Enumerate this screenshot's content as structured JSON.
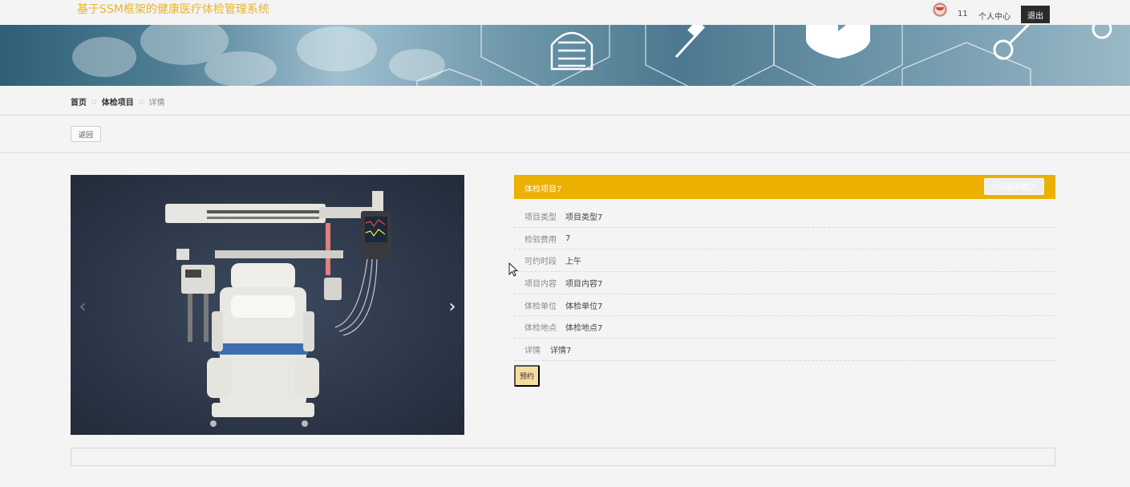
{
  "header": {
    "site_title": "基于SSM框架的健康医疗体检管理系统",
    "username": "11",
    "personal_center": "个人中心",
    "logout": "退出"
  },
  "banner": {
    "slides": 3,
    "active_slide": 1
  },
  "breadcrumb": {
    "home": "首页",
    "separator": "::",
    "section": "体检项目",
    "current": "详情"
  },
  "actions": {
    "back": "返回",
    "book": "预约"
  },
  "carousel": {
    "prev_icon": "chevron-left-icon",
    "next_icon": "chevron-right-icon",
    "prev_glyph": "‹",
    "next_glyph": "›"
  },
  "detail": {
    "title": "体检项目7",
    "favorite_label": "☆点我收藏(7)",
    "fields": [
      {
        "label": "项目类型",
        "value": "项目类型7"
      },
      {
        "label": "检验费用",
        "value": "7"
      },
      {
        "label": "可约时段",
        "value": "上午"
      },
      {
        "label": "项目内容",
        "value": "项目内容7"
      },
      {
        "label": "体检单位",
        "value": "体检单位7"
      },
      {
        "label": "体检地点",
        "value": "体检地点7"
      },
      {
        "label": "详情",
        "value": "详情7"
      }
    ]
  },
  "colors": {
    "accent": "#ebb000",
    "title": "#e9b428",
    "book_button": "#f7dca0",
    "logout_bg": "#2b2b2b"
  }
}
